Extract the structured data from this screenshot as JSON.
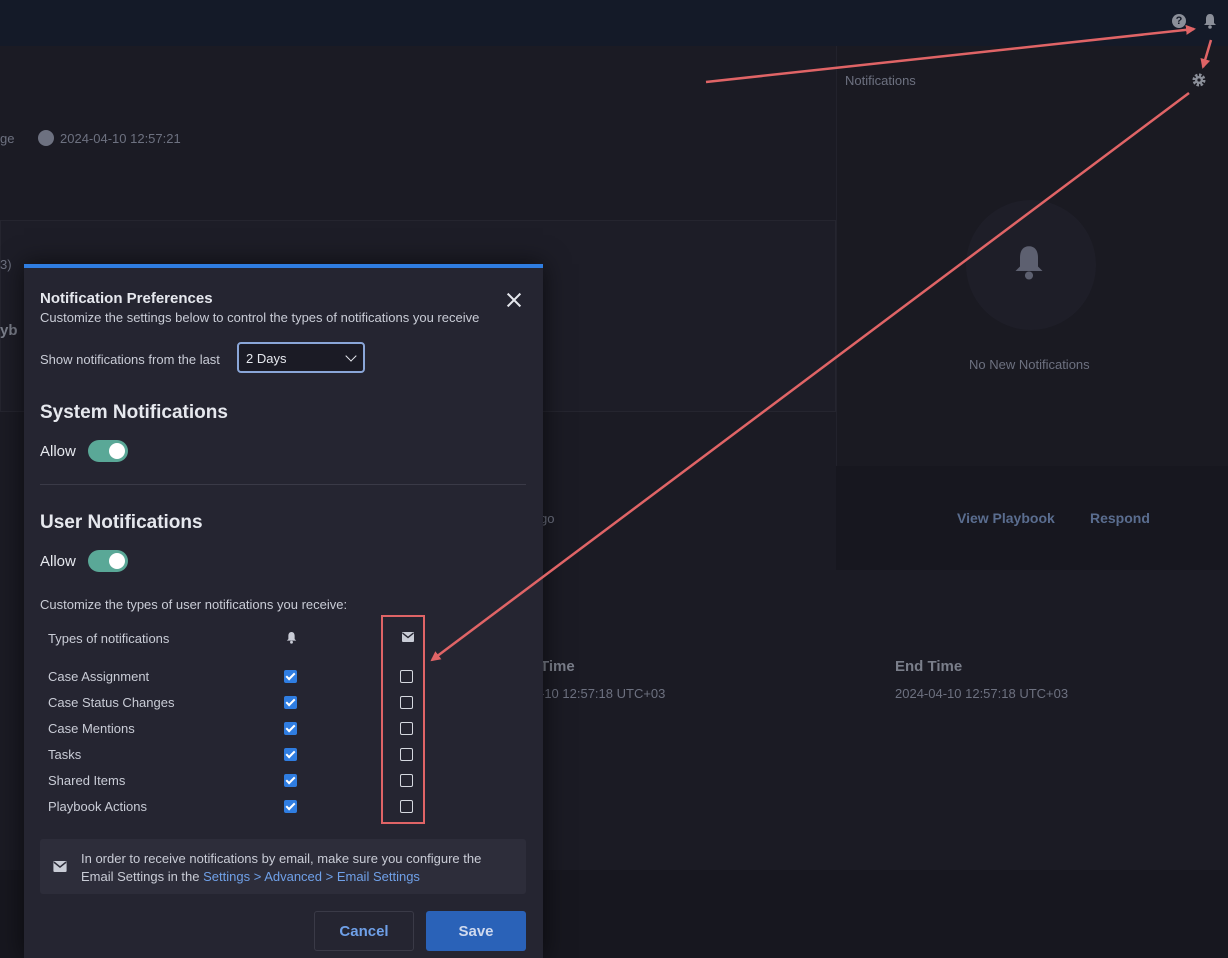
{
  "topbar": {
    "help_icon": "question-circle-icon",
    "bell_icon": "bell-icon",
    "help_glyph": "?"
  },
  "background": {
    "notifications_header": "Notifications",
    "page_fragment": "ge",
    "timestamp": "2024-04-10 12:57:21",
    "card_fragment_1": "3)",
    "card_fragment_2": "yb",
    "no_notifications": "No New Notifications",
    "time_ago_fragment": "go",
    "view_playbook": "View Playbook",
    "respond": "Respond",
    "time_fragment": "Time",
    "time_value_fragment": "-10 12:57:18 UTC+03",
    "end_time_label": "End Time",
    "end_time_value": "2024-04-10 12:57:18 UTC+03"
  },
  "modal": {
    "title": "Notification Preferences",
    "subtitle": "Customize the settings below to control the types of notifications you receive",
    "show_label": "Show notifications from the last",
    "period_selected": "2 Days",
    "system": {
      "title": "System Notifications",
      "allow_label": "Allow",
      "allowed": true
    },
    "user": {
      "title": "User Notifications",
      "allow_label": "Allow",
      "allowed": true
    },
    "customize_label": "Customize the types of user notifications you receive:",
    "table": {
      "header": "Types of notifications",
      "rows": [
        {
          "label": "Case Assignment",
          "in_app": true,
          "email": false
        },
        {
          "label": "Case Status Changes",
          "in_app": true,
          "email": false
        },
        {
          "label": "Case Mentions",
          "in_app": true,
          "email": false
        },
        {
          "label": "Tasks",
          "in_app": true,
          "email": false
        },
        {
          "label": "Shared Items",
          "in_app": true,
          "email": false
        },
        {
          "label": "Playbook Actions",
          "in_app": true,
          "email": false
        }
      ]
    },
    "info_text": "In order to receive notifications by email, make sure you configure the Email Settings in the ",
    "info_link": "Settings > Advanced > Email Settings",
    "cancel_label": "Cancel",
    "save_label": "Save"
  },
  "colors": {
    "accent": "#2f7de1",
    "toggle_on": "#5aa897",
    "annotation": "#e06466"
  }
}
